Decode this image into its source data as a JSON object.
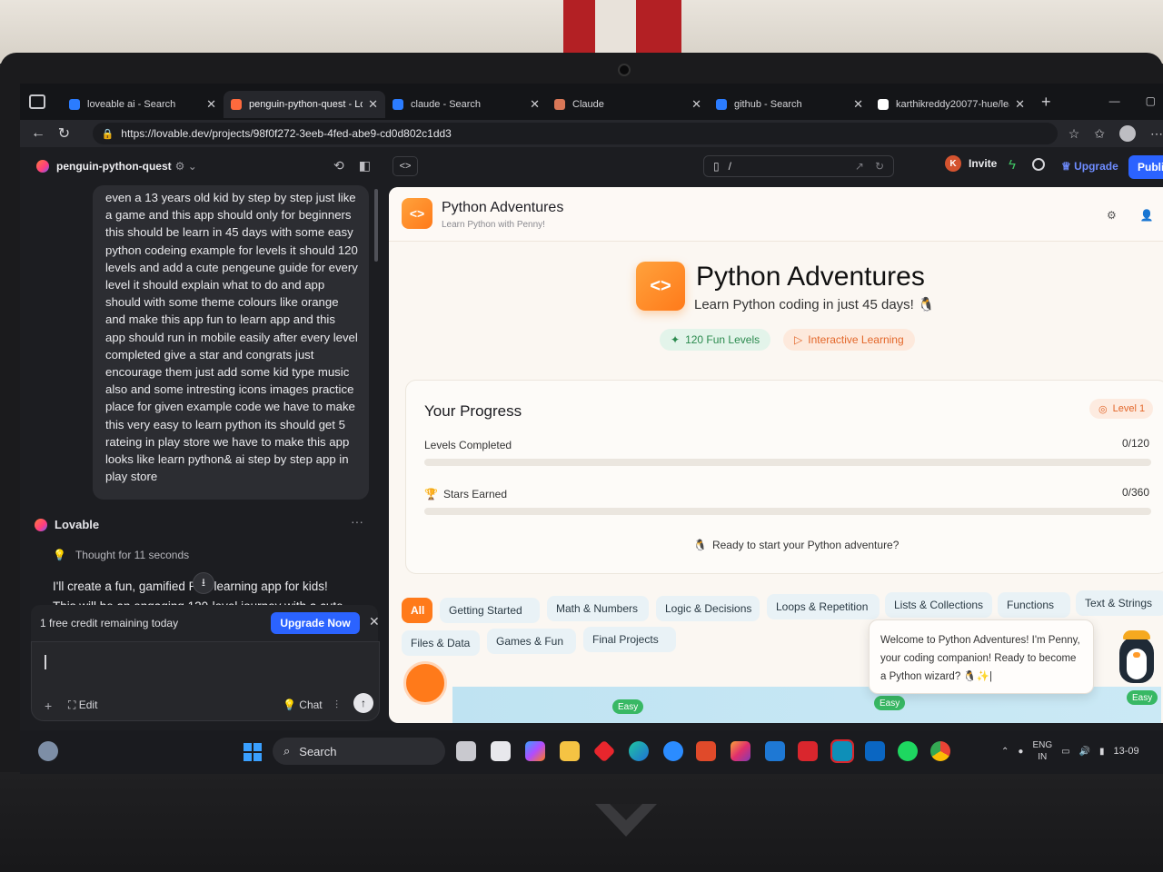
{
  "browser": {
    "tabs": [
      {
        "label": "loveable ai - Search",
        "active": false,
        "color": "#2b7cff"
      },
      {
        "label": "penguin-python-quest - Lov",
        "active": true,
        "color": "#ff6a3d"
      },
      {
        "label": "claude - Search",
        "active": false,
        "color": "#2b7cff"
      },
      {
        "label": "Claude",
        "active": false,
        "color": "#d97757"
      },
      {
        "label": "github - Search",
        "active": false,
        "color": "#2b7cff"
      },
      {
        "label": "karthikreddy20077-hue/lea",
        "active": false,
        "color": "#ffffff"
      }
    ],
    "url": "https://lovable.dev/projects/98f0f272-3eeb-4fed-abe9-cd0d802c1dd3"
  },
  "lovable_bar": {
    "project_name": "penguin-python-quest",
    "path": "/",
    "invite_avatar": "K",
    "invite_label": "Invite",
    "upgrade_label": "Upgrade",
    "publish_label": "Publis"
  },
  "chat": {
    "user_message": "even a 13 years old kid by step by step just like a game and this app should only for beginners this should be learn in 45 days with some easy python codeing example for levels it should 120 levels and add a cute pengeune guide for every level it should explain what to do and app should with some theme colours like orange and make this app fun to learn app and this app should run in mobile easily after every level completed give a star and congrats just encourage them just add some kid type music also and some intresting icons images practice place for given example code we have to make this very easy to learn python its should get 5 rateing in play store we have to make this app looks like learn python& ai step by step app in play store",
    "assistant_name": "Lovable",
    "thought": "Thought for 11 seconds",
    "reply_line1": "I'll create a fun, gamified P",
    "reply_line1_tail": "on learning app for kids!",
    "reply_line2": "This will be an engaging 120-level journey with a cute",
    "credit_text": "1 free credit remaining today",
    "upgrade_now": "Upgrade Now",
    "edit_label": "Edit",
    "chat_label": "Chat"
  },
  "app": {
    "header_title": "Python Adventures",
    "header_subtitle": "Learn Python with Penny!",
    "hero_title": "Python Adventures",
    "hero_subtitle": "Learn Python coding in just 45 days! 🐧",
    "chip_levels": "120 Fun Levels",
    "chip_interactive": "Interactive Learning",
    "progress": {
      "title": "Your Progress",
      "level_badge": "Level 1",
      "levels_label": "Levels Completed",
      "levels_value": "0/120",
      "levels_fraction": 0,
      "stars_label": "Stars Earned",
      "stars_value": "0/360",
      "stars_fraction": 0,
      "message": "Ready to start your Python adventure?"
    },
    "categories": [
      "All",
      "Getting Started",
      "Math & Numbers",
      "Logic & Decisions",
      "Loops & Repetition",
      "Lists & Collections",
      "Functions",
      "Text & Strings",
      "Files & Data",
      "Games & Fun",
      "Final Projects"
    ],
    "penny_message": "Welcome to Python Adventures! I'm Penny, your coding companion! Ready to become a Python wizard? 🐧✨|",
    "easy_label": "Easy"
  },
  "taskbar": {
    "search_label": "Search",
    "lang_top": "ENG",
    "lang_bottom": "IN",
    "clock": "13-09"
  }
}
